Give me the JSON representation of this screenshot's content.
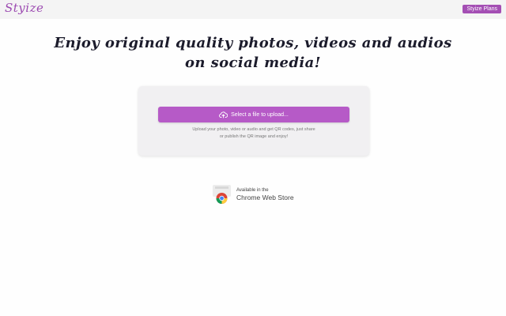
{
  "header": {
    "logo": "Styize",
    "plans_button": "Styize Plans"
  },
  "main": {
    "headline_line1": "Enjoy original quality photos, videos and audios",
    "headline_line2": "on social media!"
  },
  "upload": {
    "button_label": "Select a file to upload...",
    "help_line1": "Upload your photo, video or audio and get QR codes, just share",
    "help_line2": "or publish the QR image and enjoy!"
  },
  "store_badge": {
    "line1": "Available in the",
    "line2": "Chrome Web Store"
  },
  "colors": {
    "accent": "#b65ac7",
    "logo": "#9c4bb1",
    "headline": "#1c1c2c"
  },
  "icons": [
    "upload-cloud-icon",
    "chrome-icon"
  ]
}
